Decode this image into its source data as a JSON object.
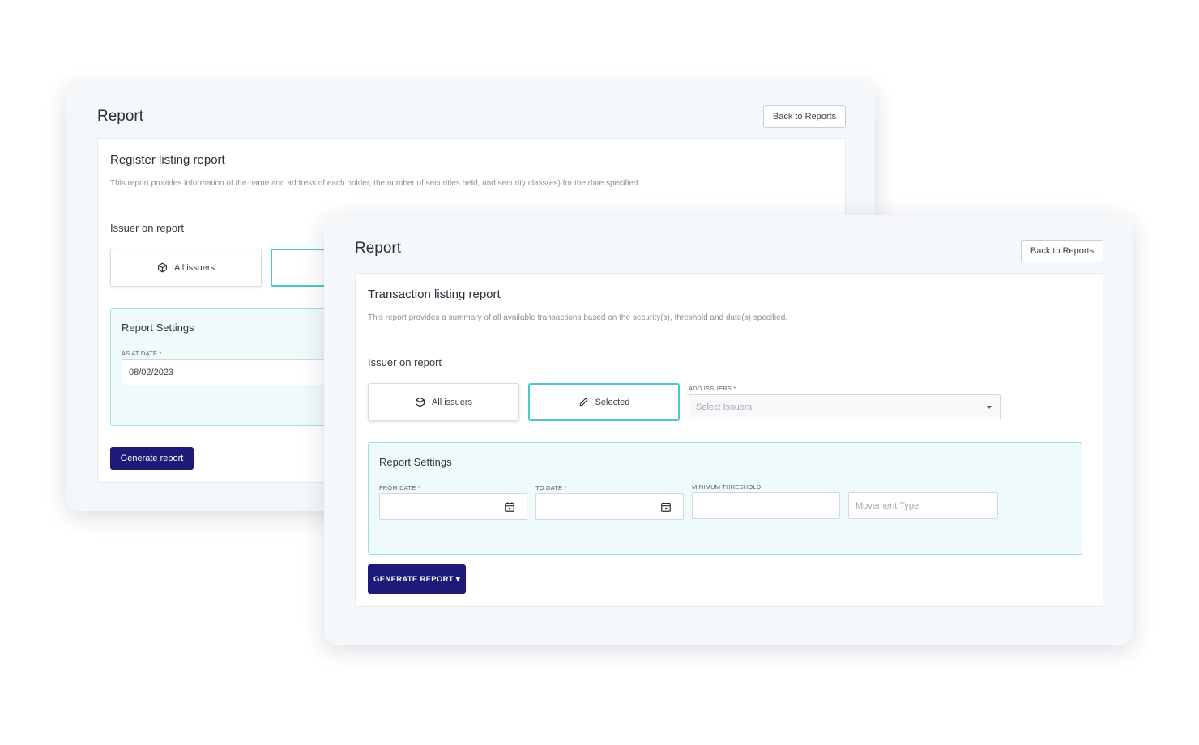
{
  "back_window": {
    "title": "Report",
    "back_button": "Back to Reports",
    "card": {
      "title": "Register listing report",
      "description": "This report provides information of the name and address of each holder, the number of securities held, and security class(es) for the date specified.",
      "issuer_label": "Issuer on report",
      "all_issuers": "All issuers",
      "settings": {
        "title": "Report Settings",
        "as_at_date_label": "AS AT DATE *",
        "as_at_date_value": "08/02/2023"
      },
      "generate_button": "Generate report"
    }
  },
  "front_window": {
    "title": "Report",
    "back_button": "Back to Reports",
    "card": {
      "title": "Transaction listing report",
      "description": "This report provides a summary of all available transactions based on the security(s), threshold and date(s) specified.",
      "issuer_label": "Issuer on report",
      "all_issuers": "All issuers",
      "selected": "Selected",
      "add_issuers_label": "ADD ISSUERS *",
      "add_issuers_placeholder": "Select Issuers",
      "settings": {
        "title": "Report Settings",
        "from_date_label": "FROM DATE *",
        "to_date_label": "TO DATE *",
        "minimum_threshold_label": "MINIMUM THRESHOLD",
        "movement_type_placeholder": "Movement Type"
      },
      "generate_button": "GENERATE REPORT ▾"
    }
  },
  "icons": {
    "issuer_all": "cube-icon",
    "issuer_selected": "pencil-icon",
    "date": "calendar-icon",
    "dropdown": "chevron-down-icon"
  },
  "colors": {
    "primary": "#1e1a78",
    "accent_teal": "#4cc6c8",
    "settings_bg": "#effafb"
  }
}
